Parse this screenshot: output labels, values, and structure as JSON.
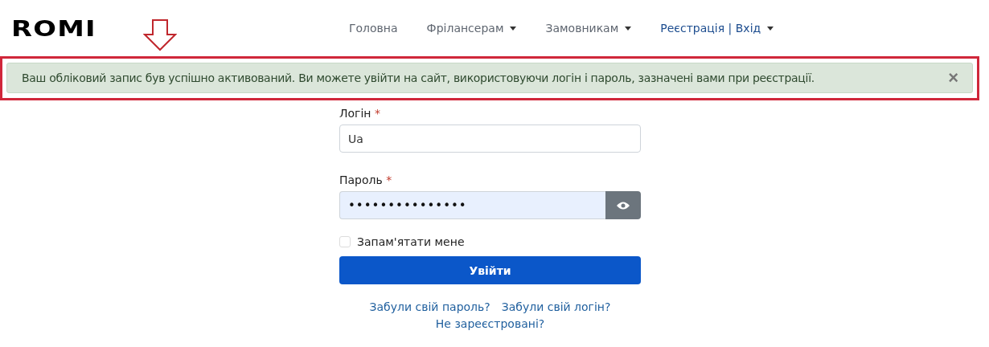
{
  "logo": "ROMI",
  "nav": [
    {
      "label": "Головна",
      "dropdown": false,
      "kind": "plain"
    },
    {
      "label": "Фрілансерам",
      "dropdown": true,
      "kind": "plain"
    },
    {
      "label": "Замовникам",
      "dropdown": true,
      "kind": "plain"
    },
    {
      "label": "Реєстрація | Вхід",
      "dropdown": true,
      "kind": "accent"
    }
  ],
  "alert": {
    "message": "Ваш обліковий запис був успішно активований. Ви можете увійти на сайт, використовуючи логін і пароль, зазначені вами при реєстрації.",
    "close": "×"
  },
  "form": {
    "login": {
      "label": "Логін",
      "required": "*",
      "value": "Ua"
    },
    "password": {
      "label": "Пароль",
      "required": "*",
      "value": "•••••••••••••••"
    },
    "remember": {
      "label": "Запам'ятати мене",
      "checked": false
    },
    "submit": "Увійти",
    "links": [
      [
        "Забули свій пароль?",
        "Забули свій логін?"
      ],
      [
        "Не зареєстровані?"
      ]
    ]
  }
}
